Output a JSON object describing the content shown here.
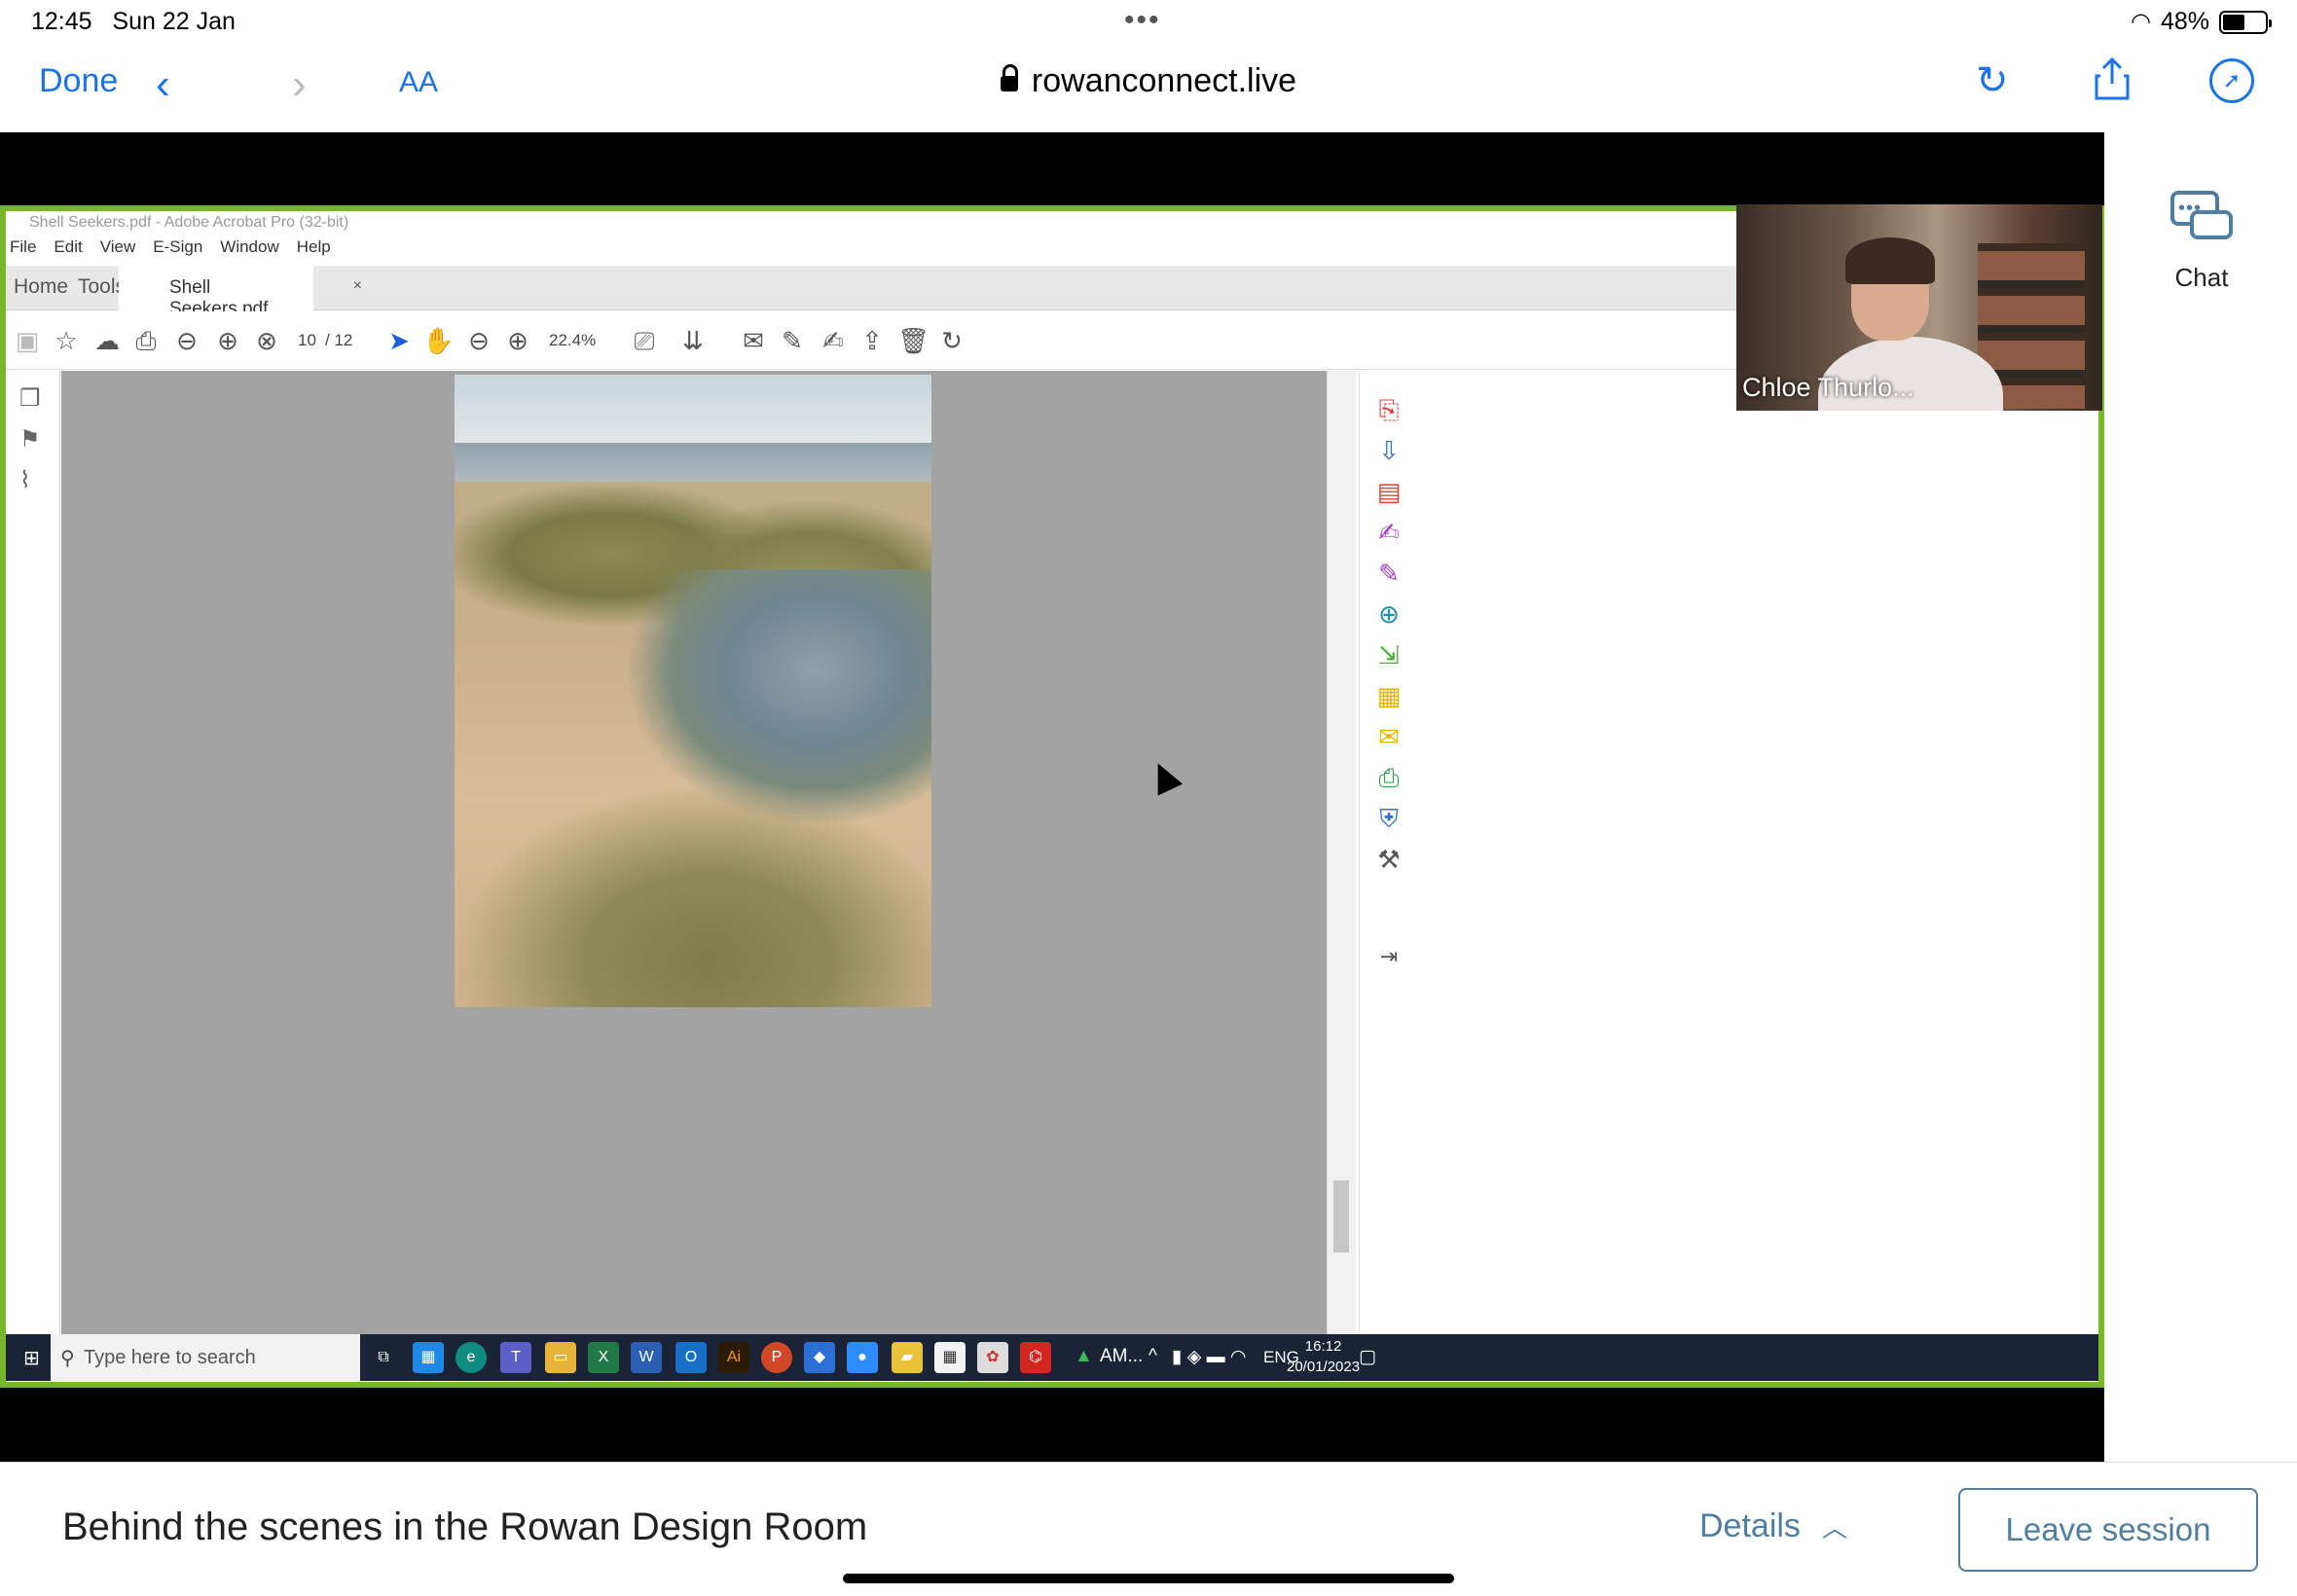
{
  "status_bar": {
    "time": "12:45",
    "date": "Sun 22 Jan",
    "battery": "48%"
  },
  "browser": {
    "done_label": "Done",
    "text_size_label": "AA",
    "url": "rowanconnect.live",
    "icons": [
      "chevron-left-icon",
      "chevron-right-icon",
      "reload-icon",
      "share-icon",
      "compass-icon"
    ]
  },
  "acrobat": {
    "window_title": "Shell Seekers.pdf - Adobe Acrobat Pro (32-bit)",
    "menu": [
      "File",
      "Edit",
      "View",
      "E-Sign",
      "Window",
      "Help"
    ],
    "tabs": {
      "home": "Home",
      "tools": "Tools",
      "document": "Shell Seekers.pdf",
      "close": "×"
    },
    "page_current": "10",
    "page_total": "/ 12",
    "zoom": "22.4%"
  },
  "windows_taskbar": {
    "search_placeholder": "Type here to search",
    "tray_app": "AM...",
    "language": "ENG",
    "time": "16:12",
    "date": "20/01/2023"
  },
  "participant": {
    "name": "Chloe Thurlo..."
  },
  "side_panel": {
    "chat_label": "Chat"
  },
  "session": {
    "title": "Behind the scenes in the Rowan Design Room",
    "details_label": "Details",
    "leave_label": "Leave session"
  },
  "colors": {
    "accent": "#1a73e8",
    "session_accent": "#4f7ea0",
    "share_border": "#76b82a"
  }
}
